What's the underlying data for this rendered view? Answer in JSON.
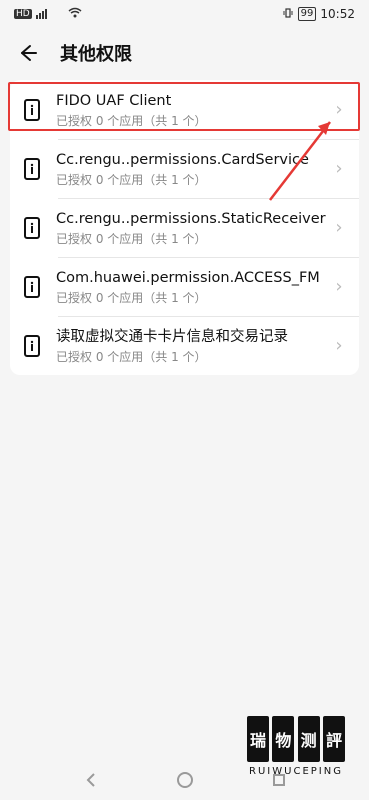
{
  "status_bar": {
    "time": "10:52",
    "hd": "HD",
    "battery": "99",
    "left_badges": [
      "4G",
      "信号",
      "WiFi"
    ],
    "right_badges": [
      "振动"
    ],
    "green_badge": "",
    "red_badge": ""
  },
  "header": {
    "title": "其他权限",
    "back_icon": "back-arrow-icon"
  },
  "list": {
    "items": [
      {
        "title": "FIDO UAF Client",
        "subtitle": "已授权 0 个应用（共 1 个）"
      },
      {
        "title": "Cc.rengu..permissions.CardService",
        "subtitle": "已授权 0 个应用（共 1 个）"
      },
      {
        "title": "Cc.rengu..permissions.StaticReceiver",
        "subtitle": "已授权 0 个应用（共 1 个）"
      },
      {
        "title": "Com.huawei.permission.ACCESS_FM",
        "subtitle": "已授权 0 个应用（共 1 个）"
      },
      {
        "title": "读取虚拟交通卡卡片信息和交易记录",
        "subtitle": "已授权 0 个应用（共 1 个）"
      }
    ]
  },
  "overlay": {
    "highlight_color": "#e53935"
  },
  "navbar": {
    "buttons": [
      "back-triangle-icon",
      "home-circle-icon",
      "recent-square-icon"
    ]
  },
  "watermark": {
    "chars": [
      "瑞",
      "物",
      "测",
      "評"
    ],
    "text": "RUIWUCEPING"
  }
}
